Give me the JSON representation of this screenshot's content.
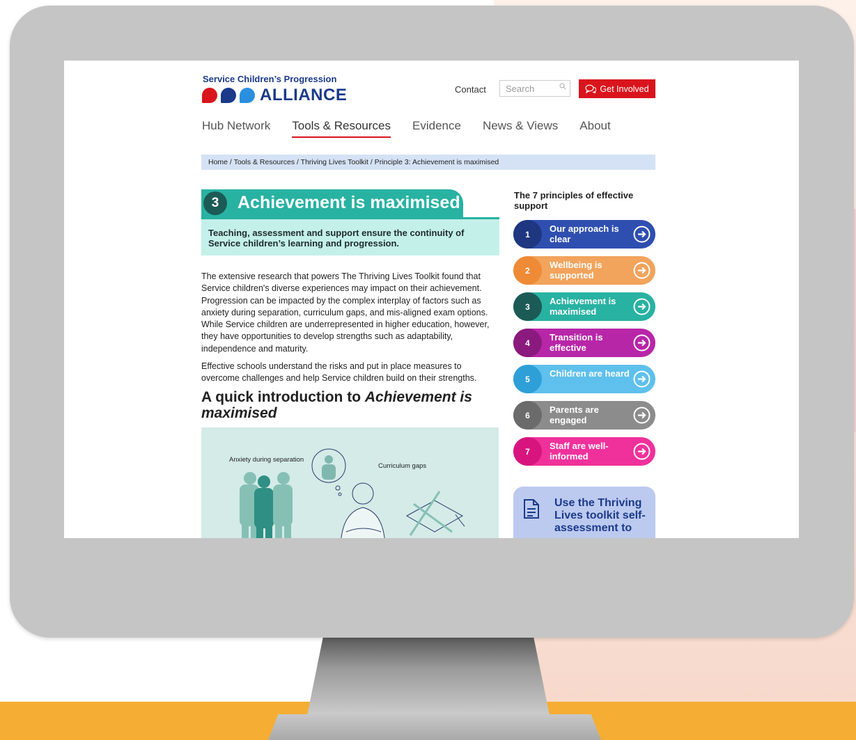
{
  "site": {
    "logo_top": "Service Children’s Progression",
    "logo_word": "ALLIANCE",
    "logo_dot_colors": [
      "#d9141c",
      "#1b3a8a",
      "#2b8fe0"
    ]
  },
  "header": {
    "contact": "Contact",
    "search_placeholder": "Search",
    "get_involved": "Get Involved",
    "accent": "#d9141c"
  },
  "nav": {
    "items": [
      {
        "label": "Hub Network"
      },
      {
        "label": "Tools & Resources"
      },
      {
        "label": "Evidence"
      },
      {
        "label": "News & Views"
      },
      {
        "label": "About"
      }
    ],
    "active_index": 1
  },
  "breadcrumb": "Home  /  Tools & Resources  /  Thriving Lives Toolkit  /  Principle 3: Achievement is maximised",
  "principle": {
    "number": "3",
    "title": "Achievement is maximised",
    "subtitle": "Teaching, assessment and support ensure the continuity of Service children’s learning and progression.",
    "color": "#28b2a2"
  },
  "body": {
    "p1": "The extensive research that powers The Thriving Lives Toolkit found that Service children's diverse experiences may impact on their achievement. Progression can be impacted by the complex interplay of factors such as anxiety during separation, curriculum gaps, and mis-aligned exam options. While Service children are underrepresented in higher education, however, they have opportunities to develop strengths such as adaptability, independence and maturity.",
    "p2": "Effective schools understand the risks and put in place measures to overcome challenges and help Service children build on their strengths.",
    "intro_prefix": "A quick introduction to ",
    "intro_emph": "Achievement is maximised"
  },
  "illustration": {
    "label1": "Anxiety during separation",
    "label2": "Curriculum gaps"
  },
  "sidebar": {
    "heading": "The 7 principles of effective support",
    "principles": [
      {
        "num": "1",
        "label": "Our approach is clear",
        "color": "#2f4fb0",
        "num_color": "#1f3680"
      },
      {
        "num": "2",
        "label": "Wellbeing is supported",
        "color": "#f2a35c",
        "num_color": "#ef8a36"
      },
      {
        "num": "3",
        "label": "Achievement is maximised",
        "color": "#28b2a2",
        "num_color": "#1c5a56"
      },
      {
        "num": "4",
        "label": "Transition is effective",
        "color": "#b826a8",
        "num_color": "#8a1a7e"
      },
      {
        "num": "5",
        "label": "Children are heard",
        "color": "#5ec0ec",
        "num_color": "#2f9fd8"
      },
      {
        "num": "6",
        "label": "Parents are engaged",
        "color": "#8c8c8c",
        "num_color": "#6b6b6b"
      },
      {
        "num": "7",
        "label": "Staff are well-informed",
        "color": "#f0319b",
        "num_color": "#d8157f"
      }
    ],
    "cta": "Use the Thriving Lives toolkit self-assessment to"
  }
}
